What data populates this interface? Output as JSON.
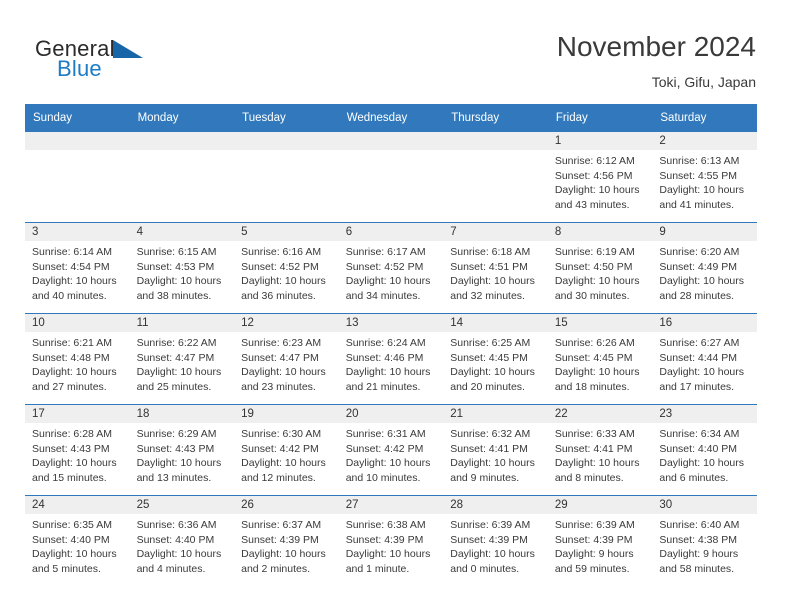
{
  "brand": {
    "name_part1": "General",
    "name_part2": "Blue",
    "accent_color": "#1d7cc4",
    "triangle_color": "#1767a8"
  },
  "header": {
    "month_title": "November 2024",
    "location": "Toki, Gifu, Japan"
  },
  "calendar": {
    "header_color": "#3179bc",
    "weekday_headers": [
      "Sunday",
      "Monday",
      "Tuesday",
      "Wednesday",
      "Thursday",
      "Friday",
      "Saturday"
    ],
    "weeks": [
      [
        {
          "date": "",
          "empty": true
        },
        {
          "date": "",
          "empty": true
        },
        {
          "date": "",
          "empty": true
        },
        {
          "date": "",
          "empty": true
        },
        {
          "date": "",
          "empty": true
        },
        {
          "date": "1",
          "sunrise": "Sunrise: 6:12 AM",
          "sunset": "Sunset: 4:56 PM",
          "daylight_line1": "Daylight: 10 hours",
          "daylight_line2": "and 43 minutes."
        },
        {
          "date": "2",
          "sunrise": "Sunrise: 6:13 AM",
          "sunset": "Sunset: 4:55 PM",
          "daylight_line1": "Daylight: 10 hours",
          "daylight_line2": "and 41 minutes."
        }
      ],
      [
        {
          "date": "3",
          "sunrise": "Sunrise: 6:14 AM",
          "sunset": "Sunset: 4:54 PM",
          "daylight_line1": "Daylight: 10 hours",
          "daylight_line2": "and 40 minutes."
        },
        {
          "date": "4",
          "sunrise": "Sunrise: 6:15 AM",
          "sunset": "Sunset: 4:53 PM",
          "daylight_line1": "Daylight: 10 hours",
          "daylight_line2": "and 38 minutes."
        },
        {
          "date": "5",
          "sunrise": "Sunrise: 6:16 AM",
          "sunset": "Sunset: 4:52 PM",
          "daylight_line1": "Daylight: 10 hours",
          "daylight_line2": "and 36 minutes."
        },
        {
          "date": "6",
          "sunrise": "Sunrise: 6:17 AM",
          "sunset": "Sunset: 4:52 PM",
          "daylight_line1": "Daylight: 10 hours",
          "daylight_line2": "and 34 minutes."
        },
        {
          "date": "7",
          "sunrise": "Sunrise: 6:18 AM",
          "sunset": "Sunset: 4:51 PM",
          "daylight_line1": "Daylight: 10 hours",
          "daylight_line2": "and 32 minutes."
        },
        {
          "date": "8",
          "sunrise": "Sunrise: 6:19 AM",
          "sunset": "Sunset: 4:50 PM",
          "daylight_line1": "Daylight: 10 hours",
          "daylight_line2": "and 30 minutes."
        },
        {
          "date": "9",
          "sunrise": "Sunrise: 6:20 AM",
          "sunset": "Sunset: 4:49 PM",
          "daylight_line1": "Daylight: 10 hours",
          "daylight_line2": "and 28 minutes."
        }
      ],
      [
        {
          "date": "10",
          "sunrise": "Sunrise: 6:21 AM",
          "sunset": "Sunset: 4:48 PM",
          "daylight_line1": "Daylight: 10 hours",
          "daylight_line2": "and 27 minutes."
        },
        {
          "date": "11",
          "sunrise": "Sunrise: 6:22 AM",
          "sunset": "Sunset: 4:47 PM",
          "daylight_line1": "Daylight: 10 hours",
          "daylight_line2": "and 25 minutes."
        },
        {
          "date": "12",
          "sunrise": "Sunrise: 6:23 AM",
          "sunset": "Sunset: 4:47 PM",
          "daylight_line1": "Daylight: 10 hours",
          "daylight_line2": "and 23 minutes."
        },
        {
          "date": "13",
          "sunrise": "Sunrise: 6:24 AM",
          "sunset": "Sunset: 4:46 PM",
          "daylight_line1": "Daylight: 10 hours",
          "daylight_line2": "and 21 minutes."
        },
        {
          "date": "14",
          "sunrise": "Sunrise: 6:25 AM",
          "sunset": "Sunset: 4:45 PM",
          "daylight_line1": "Daylight: 10 hours",
          "daylight_line2": "and 20 minutes."
        },
        {
          "date": "15",
          "sunrise": "Sunrise: 6:26 AM",
          "sunset": "Sunset: 4:45 PM",
          "daylight_line1": "Daylight: 10 hours",
          "daylight_line2": "and 18 minutes."
        },
        {
          "date": "16",
          "sunrise": "Sunrise: 6:27 AM",
          "sunset": "Sunset: 4:44 PM",
          "daylight_line1": "Daylight: 10 hours",
          "daylight_line2": "and 17 minutes."
        }
      ],
      [
        {
          "date": "17",
          "sunrise": "Sunrise: 6:28 AM",
          "sunset": "Sunset: 4:43 PM",
          "daylight_line1": "Daylight: 10 hours",
          "daylight_line2": "and 15 minutes."
        },
        {
          "date": "18",
          "sunrise": "Sunrise: 6:29 AM",
          "sunset": "Sunset: 4:43 PM",
          "daylight_line1": "Daylight: 10 hours",
          "daylight_line2": "and 13 minutes."
        },
        {
          "date": "19",
          "sunrise": "Sunrise: 6:30 AM",
          "sunset": "Sunset: 4:42 PM",
          "daylight_line1": "Daylight: 10 hours",
          "daylight_line2": "and 12 minutes."
        },
        {
          "date": "20",
          "sunrise": "Sunrise: 6:31 AM",
          "sunset": "Sunset: 4:42 PM",
          "daylight_line1": "Daylight: 10 hours",
          "daylight_line2": "and 10 minutes."
        },
        {
          "date": "21",
          "sunrise": "Sunrise: 6:32 AM",
          "sunset": "Sunset: 4:41 PM",
          "daylight_line1": "Daylight: 10 hours",
          "daylight_line2": "and 9 minutes."
        },
        {
          "date": "22",
          "sunrise": "Sunrise: 6:33 AM",
          "sunset": "Sunset: 4:41 PM",
          "daylight_line1": "Daylight: 10 hours",
          "daylight_line2": "and 8 minutes."
        },
        {
          "date": "23",
          "sunrise": "Sunrise: 6:34 AM",
          "sunset": "Sunset: 4:40 PM",
          "daylight_line1": "Daylight: 10 hours",
          "daylight_line2": "and 6 minutes."
        }
      ],
      [
        {
          "date": "24",
          "sunrise": "Sunrise: 6:35 AM",
          "sunset": "Sunset: 4:40 PM",
          "daylight_line1": "Daylight: 10 hours",
          "daylight_line2": "and 5 minutes."
        },
        {
          "date": "25",
          "sunrise": "Sunrise: 6:36 AM",
          "sunset": "Sunset: 4:40 PM",
          "daylight_line1": "Daylight: 10 hours",
          "daylight_line2": "and 4 minutes."
        },
        {
          "date": "26",
          "sunrise": "Sunrise: 6:37 AM",
          "sunset": "Sunset: 4:39 PM",
          "daylight_line1": "Daylight: 10 hours",
          "daylight_line2": "and 2 minutes."
        },
        {
          "date": "27",
          "sunrise": "Sunrise: 6:38 AM",
          "sunset": "Sunset: 4:39 PM",
          "daylight_line1": "Daylight: 10 hours",
          "daylight_line2": "and 1 minute."
        },
        {
          "date": "28",
          "sunrise": "Sunrise: 6:39 AM",
          "sunset": "Sunset: 4:39 PM",
          "daylight_line1": "Daylight: 10 hours",
          "daylight_line2": "and 0 minutes."
        },
        {
          "date": "29",
          "sunrise": "Sunrise: 6:39 AM",
          "sunset": "Sunset: 4:39 PM",
          "daylight_line1": "Daylight: 9 hours",
          "daylight_line2": "and 59 minutes."
        },
        {
          "date": "30",
          "sunrise": "Sunrise: 6:40 AM",
          "sunset": "Sunset: 4:38 PM",
          "daylight_line1": "Daylight: 9 hours",
          "daylight_line2": "and 58 minutes."
        }
      ]
    ]
  }
}
